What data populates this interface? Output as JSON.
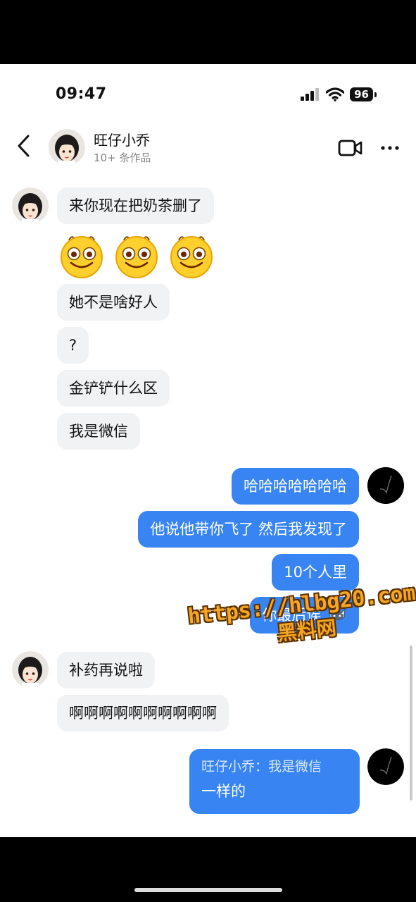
{
  "status_bar": {
    "time": "09:47",
    "battery": "96"
  },
  "header": {
    "contact_name": "旺仔小乔",
    "subtitle": "10+ 条作品"
  },
  "messages": [
    {
      "side": "in",
      "text": "来你现在把奶茶删了"
    },
    {
      "side": "in",
      "emoji": [
        "smiling-face-icon",
        "smiling-face-icon",
        "smiling-face-icon"
      ]
    },
    {
      "side": "in",
      "text": "她不是啥好人"
    },
    {
      "side": "in",
      "text": "?"
    },
    {
      "side": "in",
      "text": "金铲铲什么区"
    },
    {
      "side": "in",
      "text": "我是微信"
    },
    {
      "side": "out",
      "text": "哈哈哈哈哈哈哈"
    },
    {
      "side": "out",
      "text": "他说他带你飞了 然后我发现了"
    },
    {
      "side": "out",
      "text": "10个人里"
    },
    {
      "side": "out",
      "text": "你最后诶"
    },
    {
      "side": "in",
      "text": "补药再说啦"
    },
    {
      "side": "in",
      "text": "啊啊啊啊啊啊啊啊啊啊"
    },
    {
      "side": "out",
      "quote": "旺仔小乔：我是微信",
      "text": "一样的"
    }
  ],
  "watermark": {
    "url": "https://hlbg20.com",
    "site": "黑料网"
  },
  "colors": {
    "outgoing_bubble": "#3784f2",
    "incoming_bubble": "#f1f2f4",
    "watermark": "#f5a623"
  }
}
